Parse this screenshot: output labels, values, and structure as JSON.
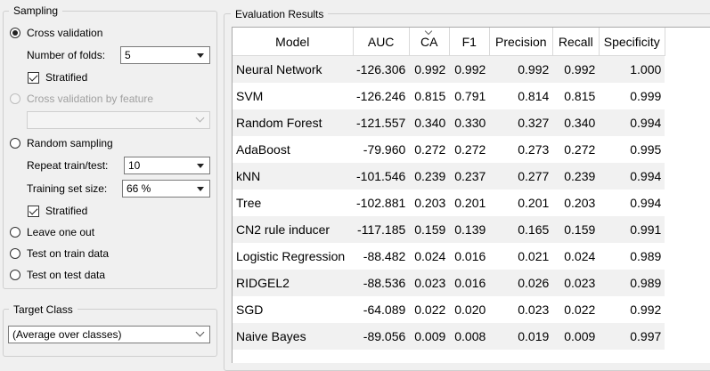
{
  "sampling": {
    "title": "Sampling",
    "cross_validation": "Cross validation",
    "folds_label": "Number of folds:",
    "folds_value": "5",
    "stratified_1": "Stratified",
    "cv_by_feature": "Cross validation by feature",
    "random_sampling": "Random sampling",
    "repeat_label": "Repeat train/test:",
    "repeat_value": "10",
    "train_size_label": "Training set size:",
    "train_size_value": "66 %",
    "stratified_2": "Stratified",
    "leave_one_out": "Leave one out",
    "test_on_train": "Test on train data",
    "test_on_test": "Test on test data"
  },
  "target": {
    "title": "Target Class",
    "value": "(Average over classes)"
  },
  "results": {
    "title": "Evaluation Results",
    "columns": [
      "Model",
      "AUC",
      "CA",
      "F1",
      "Precision",
      "Recall",
      "Specificity"
    ],
    "rows": [
      [
        "Neural Network",
        "-126.306",
        "0.992",
        "0.992",
        "0.992",
        "0.992",
        "1.000"
      ],
      [
        "SVM",
        "-126.246",
        "0.815",
        "0.791",
        "0.814",
        "0.815",
        "0.999"
      ],
      [
        "Random Forest",
        "-121.557",
        "0.340",
        "0.330",
        "0.327",
        "0.340",
        "0.994"
      ],
      [
        "AdaBoost",
        "-79.960",
        "0.272",
        "0.272",
        "0.273",
        "0.272",
        "0.995"
      ],
      [
        "kNN",
        "-101.546",
        "0.239",
        "0.237",
        "0.277",
        "0.239",
        "0.994"
      ],
      [
        "Tree",
        "-102.881",
        "0.203",
        "0.201",
        "0.201",
        "0.203",
        "0.994"
      ],
      [
        "CN2 rule inducer",
        "-117.185",
        "0.159",
        "0.139",
        "0.165",
        "0.159",
        "0.991"
      ],
      [
        "Logistic Regression",
        "-88.482",
        "0.024",
        "0.016",
        "0.021",
        "0.024",
        "0.989"
      ],
      [
        "RIDGEL2",
        "-88.536",
        "0.023",
        "0.016",
        "0.026",
        "0.023",
        "0.989"
      ],
      [
        "SGD",
        "-64.089",
        "0.022",
        "0.020",
        "0.023",
        "0.022",
        "0.992"
      ],
      [
        "Naive Bayes",
        "-89.056",
        "0.009",
        "0.008",
        "0.019",
        "0.009",
        "0.997"
      ]
    ]
  }
}
